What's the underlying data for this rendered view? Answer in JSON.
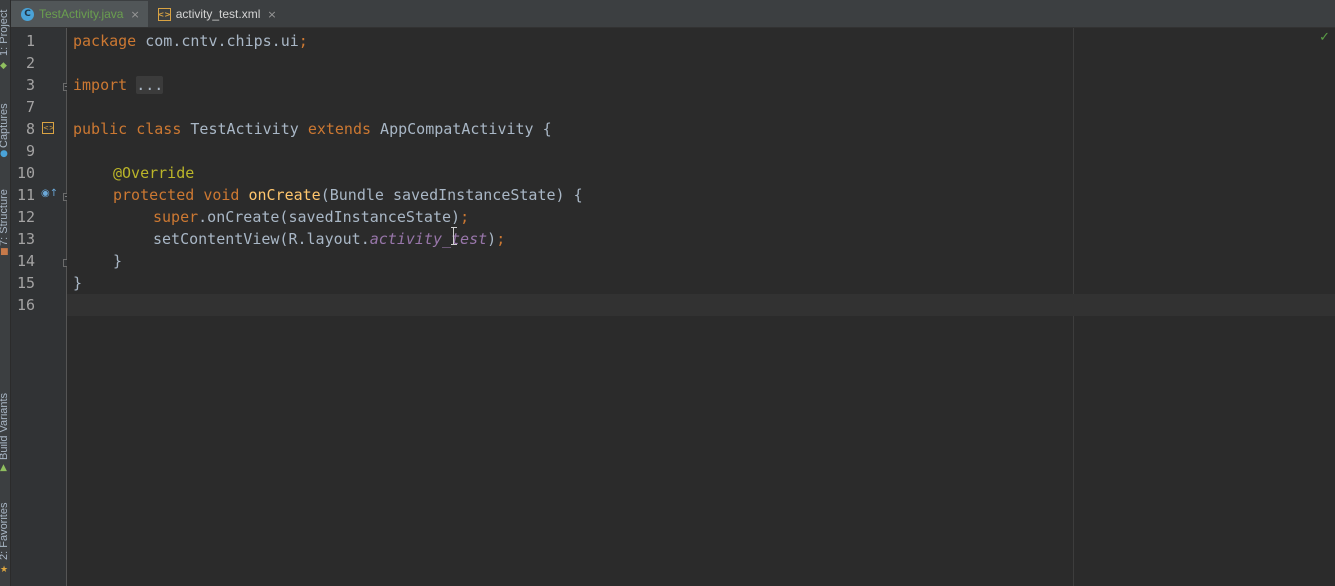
{
  "left_strip": {
    "project_label": "1: Project",
    "captures_label": "Captures",
    "structure_label": "7: Structure",
    "build_variants_label": "Build Variants",
    "favorites_label": "2: Favorites"
  },
  "tabs": [
    {
      "label": "TestActivity.java",
      "icon": "java-class-icon",
      "icon_glyph": "C",
      "active": true
    },
    {
      "label": "activity_test.xml",
      "icon": "xml-layout-icon",
      "icon_glyph": "<>",
      "active": false
    }
  ],
  "tab_close_glyph": "×",
  "editor": {
    "line_numbers": [
      "1",
      "2",
      "3",
      "7",
      "8",
      "9",
      "10",
      "11",
      "12",
      "13",
      "14",
      "15",
      "16"
    ],
    "code": {
      "l1_kw": "package",
      "l1_rest": " com.cntv.chips.ui",
      "l1_semi": ";",
      "l3_kw": "import",
      "l3_folded": "...",
      "l8_kw1": "public",
      "l8_kw2": "class",
      "l8_name": " TestActivity ",
      "l8_kw3": "extends",
      "l8_rest": " AppCompatActivity {",
      "l10_ann": "@Override",
      "l11_kw1": "protected",
      "l11_kw2": "void",
      "l11_fn": "onCreate",
      "l11_rest": "(Bundle savedInstanceState) {",
      "l12_kw": "super",
      "l12_rest": ".onCreate(savedInstanceState)",
      "l12_semi": ";",
      "l13_rest": "setContentView(R.layout.",
      "l13_field": "activity_test",
      "l13_close": ")",
      "l13_semi": ";",
      "l14": "}",
      "l15": "}"
    },
    "status_check": "✓",
    "colors": {
      "keyword": "#cc7832",
      "annotation": "#bbb529",
      "method": "#ffc66d",
      "field": "#9876aa",
      "text": "#a9b7c6",
      "background": "#2b2b2b"
    }
  }
}
